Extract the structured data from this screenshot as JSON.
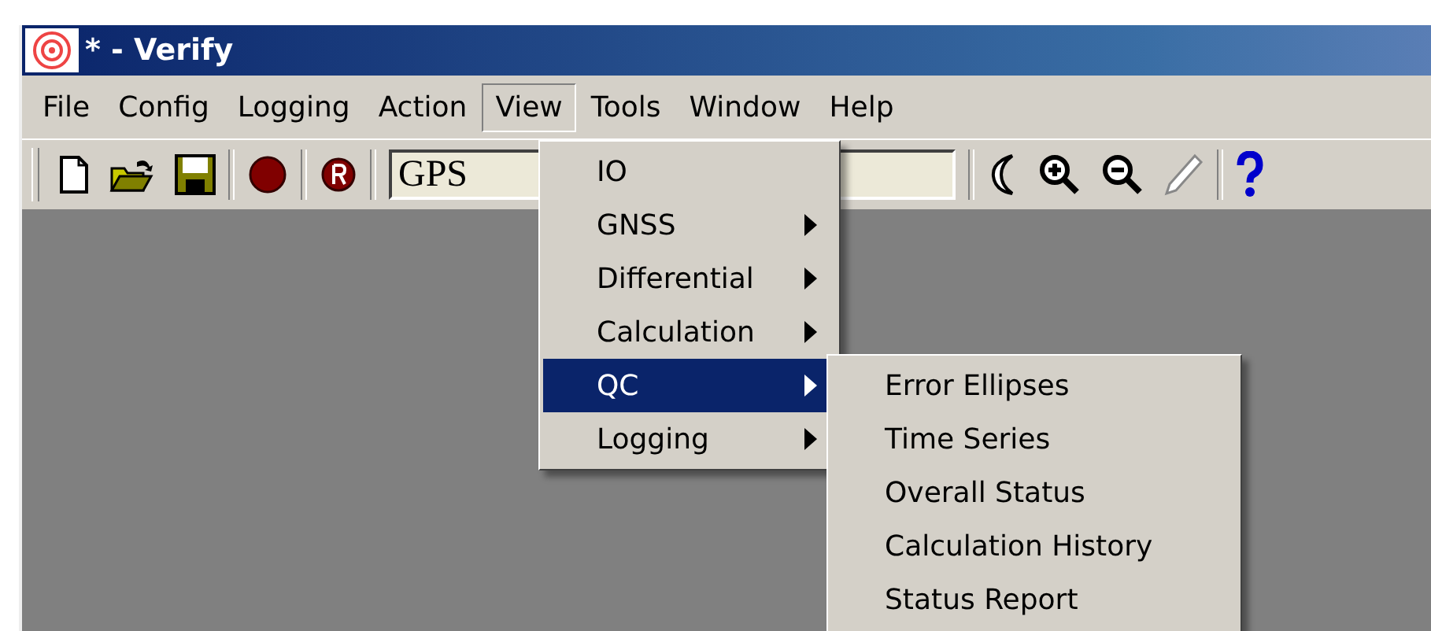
{
  "window": {
    "title": "* - Verify"
  },
  "menu_bar": [
    {
      "label": "File",
      "selected": false
    },
    {
      "label": "Config",
      "selected": false
    },
    {
      "label": "Logging",
      "selected": false
    },
    {
      "label": "Action",
      "selected": false
    },
    {
      "label": "View",
      "selected": true
    },
    {
      "label": "Tools",
      "selected": false
    },
    {
      "label": "Window",
      "selected": false
    },
    {
      "label": "Help",
      "selected": false
    }
  ],
  "toolbar": {
    "combo_value": "GPS"
  },
  "view_menu": [
    {
      "label": "IO",
      "submenu": false,
      "selected": false
    },
    {
      "label": "GNSS",
      "submenu": true,
      "selected": false
    },
    {
      "label": "Differential",
      "submenu": true,
      "selected": false
    },
    {
      "label": "Calculation",
      "submenu": true,
      "selected": false
    },
    {
      "label": "QC",
      "submenu": true,
      "selected": true
    },
    {
      "label": "Logging",
      "submenu": true,
      "selected": false
    }
  ],
  "qc_submenu": [
    {
      "label": "Error Ellipses"
    },
    {
      "label": "Time Series"
    },
    {
      "label": "Overall Status"
    },
    {
      "label": "Calculation History"
    },
    {
      "label": "Status Report"
    }
  ]
}
